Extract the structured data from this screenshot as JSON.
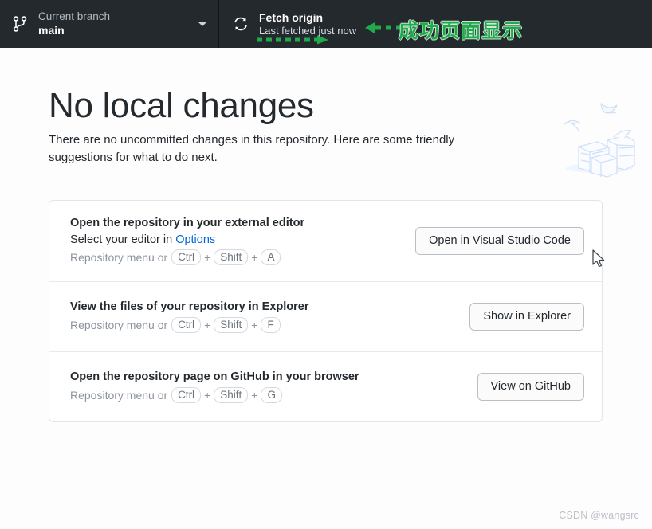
{
  "toolbar": {
    "branch": {
      "icon": "git-branch-icon",
      "label": "Current branch",
      "value": "main",
      "caret_icon": "chevron-down-icon"
    },
    "fetch": {
      "icon": "sync-refresh-icon",
      "label": "Fetch origin",
      "sub": "Last fetched just now"
    }
  },
  "annotation": {
    "text": "成功页面显示",
    "color": "#1faa4b"
  },
  "hero": {
    "title": "No local changes",
    "subtitle": "There are no uncommitted changes in this repository. Here are some friendly suggestions for what to do next.",
    "art_icon": "boxes-and-birds-illustration"
  },
  "suggestions": [
    {
      "title": "Open the repository in your external editor",
      "desc_prefix": "Select your editor in ",
      "desc_link": "Options",
      "hint_prefix": "Repository menu or",
      "keys": [
        "Ctrl",
        "Shift",
        "A"
      ],
      "button": "Open in Visual Studio Code"
    },
    {
      "title": "View the files of your repository in Explorer",
      "desc_prefix": "",
      "desc_link": "",
      "hint_prefix": "Repository menu or",
      "keys": [
        "Ctrl",
        "Shift",
        "F"
      ],
      "button": "Show in Explorer"
    },
    {
      "title": "Open the repository page on GitHub in your browser",
      "desc_prefix": "",
      "desc_link": "",
      "hint_prefix": "Repository menu or",
      "keys": [
        "Ctrl",
        "Shift",
        "G"
      ],
      "button": "View on GitHub"
    }
  ],
  "watermark": "CSDN @wangsrc",
  "cursor": {
    "icon": "mouse-pointer-icon"
  }
}
